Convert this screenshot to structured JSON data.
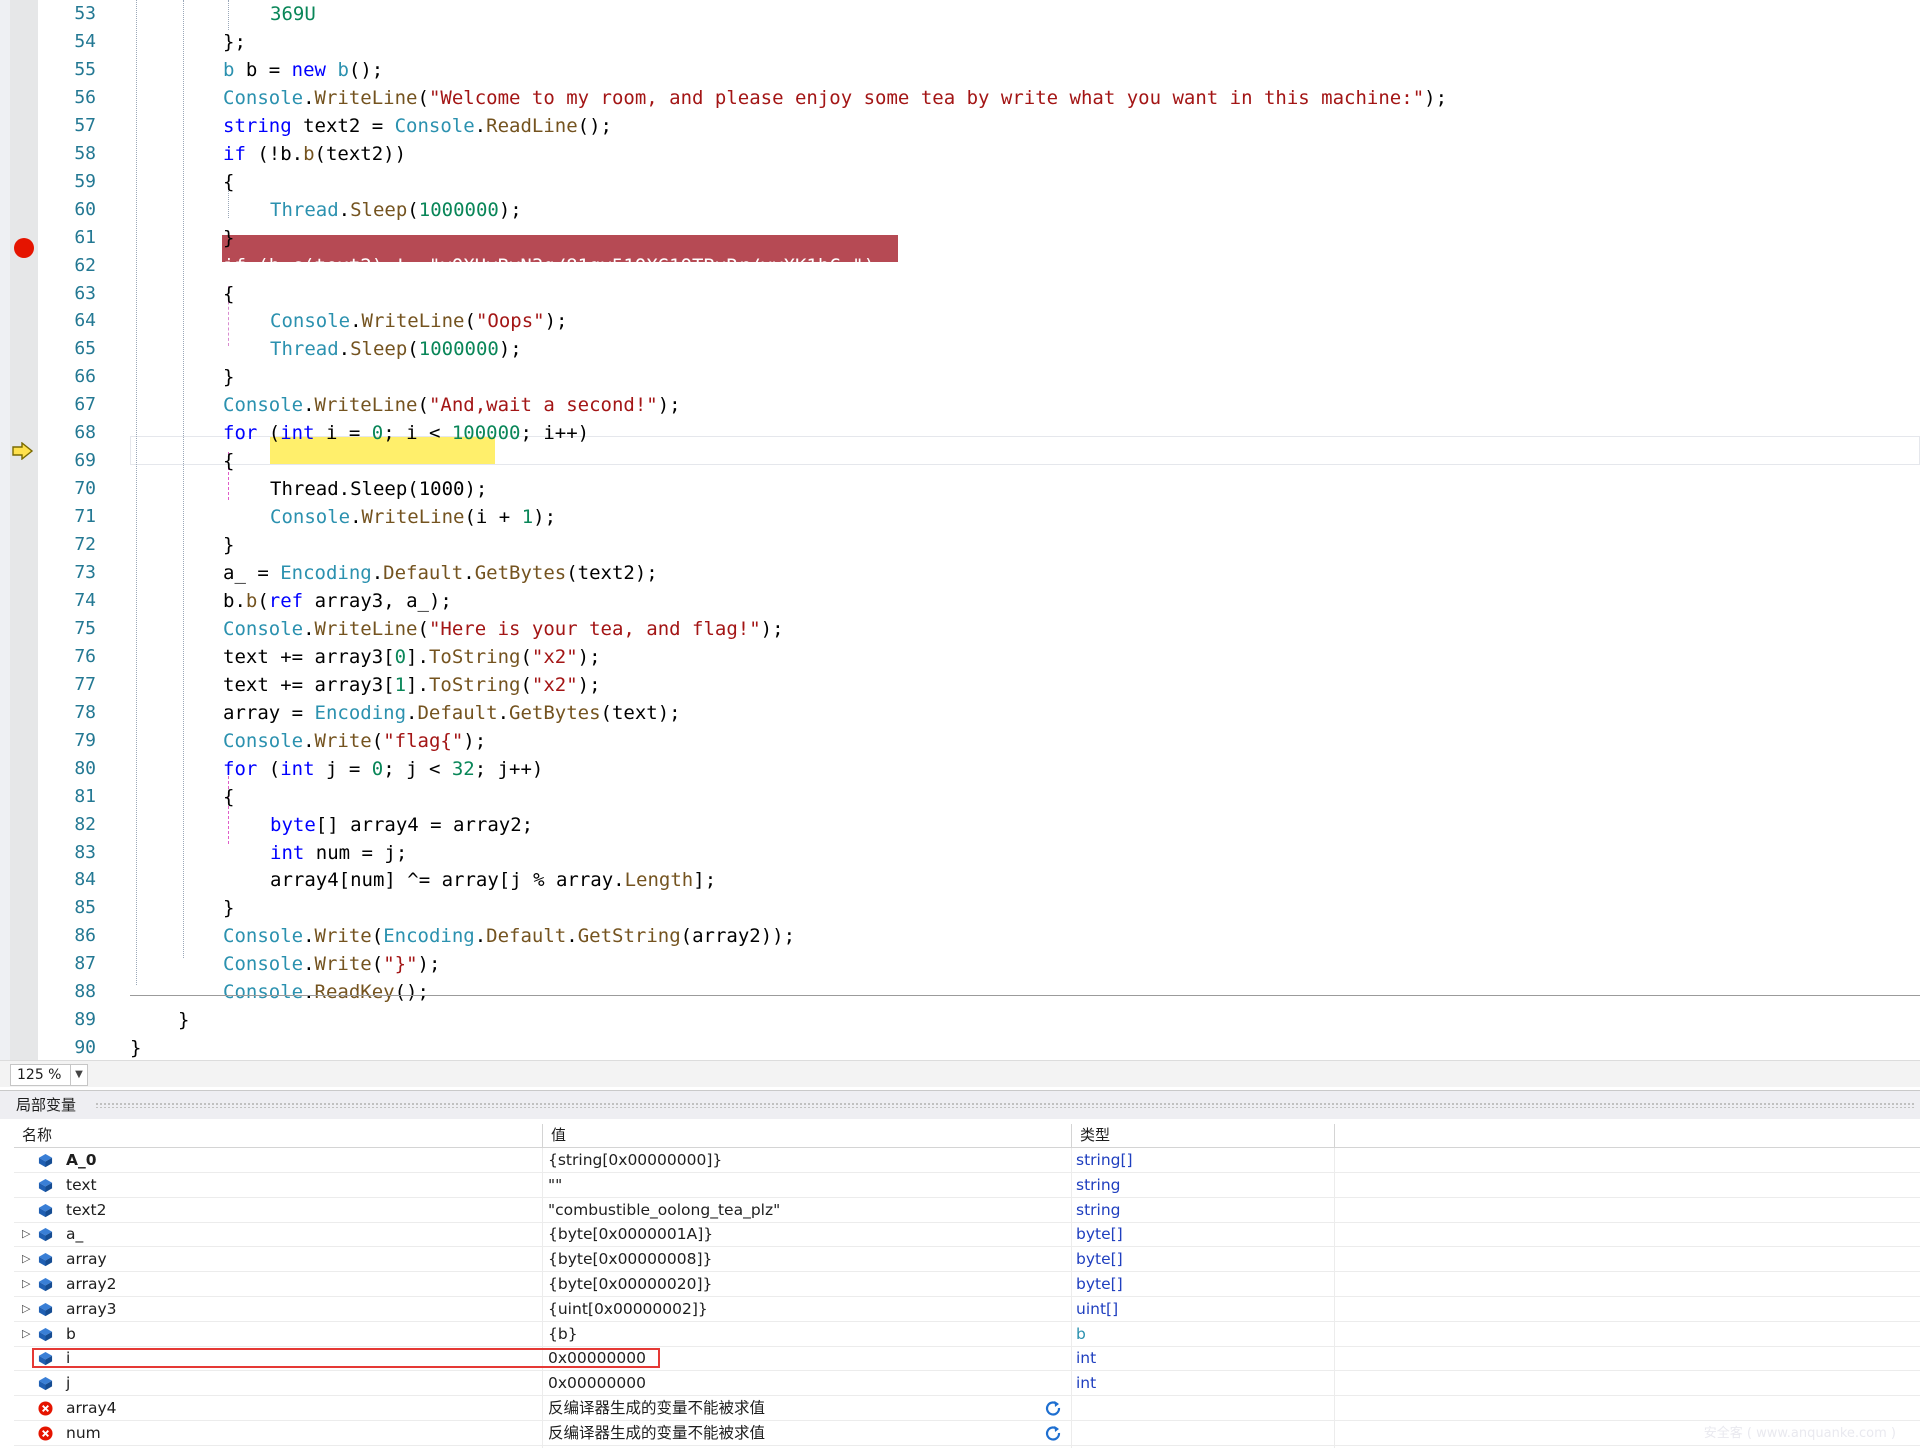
{
  "editor": {
    "zoom": "125 %",
    "lines": [
      {
        "n": "53",
        "indent": 2,
        "t": [
          [
            "num",
            "369U"
          ]
        ]
      },
      {
        "n": "54",
        "indent": 1,
        "t": [
          [
            "",
            "};"
          ]
        ]
      },
      {
        "n": "55",
        "indent": 1,
        "t": [
          [
            "typ",
            "b"
          ],
          [
            "",
            " b = "
          ],
          [
            "kw",
            "new"
          ],
          [
            "",
            " "
          ],
          [
            "typ",
            "b"
          ],
          [
            "",
            "();"
          ]
        ]
      },
      {
        "n": "56",
        "indent": 1,
        "t": [
          [
            "typ",
            "Console"
          ],
          [
            "",
            "."
          ],
          [
            "fn",
            "WriteLine"
          ],
          [
            "",
            "("
          ],
          [
            "str",
            "\"Welcome to my room, and please enjoy some tea by write what you want in this machine:\""
          ],
          [
            "",
            ");"
          ]
        ]
      },
      {
        "n": "57",
        "indent": 1,
        "t": [
          [
            "kw",
            "string"
          ],
          [
            "",
            " text2 = "
          ],
          [
            "typ",
            "Console"
          ],
          [
            "",
            "."
          ],
          [
            "fn",
            "ReadLine"
          ],
          [
            "",
            "();"
          ]
        ]
      },
      {
        "n": "58",
        "indent": 1,
        "t": [
          [
            "kw",
            "if"
          ],
          [
            "",
            " (!b."
          ],
          [
            "fn",
            "b"
          ],
          [
            "",
            "(text2))"
          ]
        ]
      },
      {
        "n": "59",
        "indent": 1,
        "t": [
          [
            "",
            "{"
          ]
        ]
      },
      {
        "n": "60",
        "indent": 2,
        "t": [
          [
            "typ",
            "Thread"
          ],
          [
            "",
            "."
          ],
          [
            "fn",
            "Sleep"
          ],
          [
            "",
            "("
          ],
          [
            "num",
            "1000000"
          ],
          [
            "",
            ");"
          ]
        ]
      },
      {
        "n": "61",
        "indent": 1,
        "t": [
          [
            "",
            "}"
          ]
        ]
      },
      {
        "n": "62",
        "indent": 1,
        "bp": true,
        "t": [
          [
            "",
            "if (b.c(text2) != \"yQXHyBvN3g/81gv51QXG1QTBxRr/yvXK1hC=\")"
          ]
        ]
      },
      {
        "n": "63",
        "indent": 1,
        "t": [
          [
            "",
            "{"
          ]
        ]
      },
      {
        "n": "64",
        "indent": 2,
        "t": [
          [
            "typ",
            "Console"
          ],
          [
            "",
            "."
          ],
          [
            "fn",
            "WriteLine"
          ],
          [
            "",
            "("
          ],
          [
            "str",
            "\"Oops\""
          ],
          [
            "",
            ");"
          ]
        ]
      },
      {
        "n": "65",
        "indent": 2,
        "t": [
          [
            "typ",
            "Thread"
          ],
          [
            "",
            "."
          ],
          [
            "fn",
            "Sleep"
          ],
          [
            "",
            "("
          ],
          [
            "num",
            "1000000"
          ],
          [
            "",
            ");"
          ]
        ]
      },
      {
        "n": "66",
        "indent": 1,
        "t": [
          [
            "",
            "}"
          ]
        ]
      },
      {
        "n": "67",
        "indent": 1,
        "t": [
          [
            "typ",
            "Console"
          ],
          [
            "",
            "."
          ],
          [
            "fn",
            "WriteLine"
          ],
          [
            "",
            "("
          ],
          [
            "str",
            "\"And,wait a second!\""
          ],
          [
            "",
            ");"
          ]
        ]
      },
      {
        "n": "68",
        "indent": 1,
        "t": [
          [
            "kw",
            "for"
          ],
          [
            "",
            " ("
          ],
          [
            "kw",
            "int"
          ],
          [
            "",
            " i = "
          ],
          [
            "num",
            "0"
          ],
          [
            "",
            "; i < "
          ],
          [
            "num",
            "100000"
          ],
          [
            "",
            "; i++)"
          ]
        ]
      },
      {
        "n": "69",
        "indent": 1,
        "t": [
          [
            "",
            "{"
          ]
        ]
      },
      {
        "n": "70",
        "indent": 2,
        "cur": true,
        "t": [
          [
            "",
            "Thread.Sleep(1000);"
          ]
        ]
      },
      {
        "n": "71",
        "indent": 2,
        "t": [
          [
            "typ",
            "Console"
          ],
          [
            "",
            "."
          ],
          [
            "fn",
            "WriteLine"
          ],
          [
            "",
            "(i + "
          ],
          [
            "num",
            "1"
          ],
          [
            "",
            ");"
          ]
        ]
      },
      {
        "n": "72",
        "indent": 1,
        "t": [
          [
            "",
            "}"
          ]
        ]
      },
      {
        "n": "73",
        "indent": 1,
        "t": [
          [
            "",
            "a_ = "
          ],
          [
            "typ",
            "Encoding"
          ],
          [
            "",
            "."
          ],
          [
            "fn",
            "Default"
          ],
          [
            "",
            "."
          ],
          [
            "fn",
            "GetBytes"
          ],
          [
            "",
            "(text2);"
          ]
        ]
      },
      {
        "n": "74",
        "indent": 1,
        "t": [
          [
            "",
            "b."
          ],
          [
            "fn",
            "b"
          ],
          [
            "",
            "("
          ],
          [
            "kw",
            "ref"
          ],
          [
            "",
            " array3, a_);"
          ]
        ]
      },
      {
        "n": "75",
        "indent": 1,
        "t": [
          [
            "typ",
            "Console"
          ],
          [
            "",
            "."
          ],
          [
            "fn",
            "WriteLine"
          ],
          [
            "",
            "("
          ],
          [
            "str",
            "\"Here is your tea, and flag!\""
          ],
          [
            "",
            ");"
          ]
        ]
      },
      {
        "n": "76",
        "indent": 1,
        "t": [
          [
            "",
            "text += array3["
          ],
          [
            "num",
            "0"
          ],
          [
            "",
            "]."
          ],
          [
            "fn",
            "ToString"
          ],
          [
            "",
            "("
          ],
          [
            "str",
            "\"x2\""
          ],
          [
            "",
            ");"
          ]
        ]
      },
      {
        "n": "77",
        "indent": 1,
        "t": [
          [
            "",
            "text += array3["
          ],
          [
            "num",
            "1"
          ],
          [
            "",
            "]."
          ],
          [
            "fn",
            "ToString"
          ],
          [
            "",
            "("
          ],
          [
            "str",
            "\"x2\""
          ],
          [
            "",
            ");"
          ]
        ]
      },
      {
        "n": "78",
        "indent": 1,
        "t": [
          [
            "",
            "array = "
          ],
          [
            "typ",
            "Encoding"
          ],
          [
            "",
            "."
          ],
          [
            "fn",
            "Default"
          ],
          [
            "",
            "."
          ],
          [
            "fn",
            "GetBytes"
          ],
          [
            "",
            "(text);"
          ]
        ]
      },
      {
        "n": "79",
        "indent": 1,
        "t": [
          [
            "typ",
            "Console"
          ],
          [
            "",
            "."
          ],
          [
            "fn",
            "Write"
          ],
          [
            "",
            "("
          ],
          [
            "str",
            "\"flag{\""
          ],
          [
            "",
            ");"
          ]
        ]
      },
      {
        "n": "80",
        "indent": 1,
        "t": [
          [
            "kw",
            "for"
          ],
          [
            "",
            " ("
          ],
          [
            "kw",
            "int"
          ],
          [
            "",
            " j = "
          ],
          [
            "num",
            "0"
          ],
          [
            "",
            "; j < "
          ],
          [
            "num",
            "32"
          ],
          [
            "",
            "; j++)"
          ]
        ]
      },
      {
        "n": "81",
        "indent": 1,
        "t": [
          [
            "",
            "{"
          ]
        ]
      },
      {
        "n": "82",
        "indent": 2,
        "t": [
          [
            "kw",
            "byte"
          ],
          [
            "",
            "[] array4 = array2;"
          ]
        ]
      },
      {
        "n": "83",
        "indent": 2,
        "t": [
          [
            "kw",
            "int"
          ],
          [
            "",
            " num = j;"
          ]
        ]
      },
      {
        "n": "84",
        "indent": 2,
        "t": [
          [
            "",
            "array4[num] ^= array[j % array."
          ],
          [
            "fn",
            "Length"
          ],
          [
            "",
            "];"
          ]
        ]
      },
      {
        "n": "85",
        "indent": 1,
        "t": [
          [
            "",
            "}"
          ]
        ]
      },
      {
        "n": "86",
        "indent": 1,
        "t": [
          [
            "typ",
            "Console"
          ],
          [
            "",
            "."
          ],
          [
            "fn",
            "Write"
          ],
          [
            "",
            "("
          ],
          [
            "typ",
            "Encoding"
          ],
          [
            "",
            "."
          ],
          [
            "fn",
            "Default"
          ],
          [
            "",
            "."
          ],
          [
            "fn",
            "GetString"
          ],
          [
            "",
            "(array2));"
          ]
        ]
      },
      {
        "n": "87",
        "indent": 1,
        "t": [
          [
            "typ",
            "Console"
          ],
          [
            "",
            "."
          ],
          [
            "fn",
            "Write"
          ],
          [
            "",
            "("
          ],
          [
            "str",
            "\"}\""
          ],
          [
            "",
            ");"
          ]
        ]
      },
      {
        "n": "88",
        "indent": 1,
        "t": [
          [
            "typ",
            "Console"
          ],
          [
            "",
            "."
          ],
          [
            "fn",
            "ReadKey"
          ],
          [
            "",
            "();"
          ]
        ]
      },
      {
        "n": "89",
        "indent": -1,
        "t": [
          [
            "",
            "}"
          ]
        ]
      },
      {
        "n": "90",
        "indent": -2,
        "t": [
          [
            "",
            "}"
          ]
        ]
      },
      {
        "n": "91",
        "indent": -2,
        "t": [
          [
            "",
            ""
          ]
        ]
      }
    ]
  },
  "locals": {
    "title": "局部变量",
    "headers": {
      "name": "名称",
      "value": "值",
      "type": "类型"
    },
    "rows": [
      {
        "expand": false,
        "icon": "field",
        "name": "A_0",
        "bold": true,
        "value": "{string[0x00000000]}",
        "value_style": "blue",
        "type": "string[]",
        "type_style": "blue"
      },
      {
        "expand": false,
        "icon": "field",
        "name": "text",
        "value": "\"\"",
        "value_style": "red",
        "type": "string",
        "type_style": "blue"
      },
      {
        "expand": false,
        "icon": "field",
        "name": "text2",
        "value": "\"combustible_oolong_tea_plz\"",
        "value_style": "red",
        "type": "string",
        "type_style": "blue"
      },
      {
        "expand": true,
        "icon": "field",
        "name": "a_",
        "value": "{byte[0x0000001A]}",
        "value_style": "blue",
        "type": "byte[]",
        "type_style": "blue"
      },
      {
        "expand": true,
        "icon": "field",
        "name": "array",
        "value": "{byte[0x00000008]}",
        "value_style": "blue",
        "type": "byte[]",
        "type_style": "blue"
      },
      {
        "expand": true,
        "icon": "field",
        "name": "array2",
        "value": "{byte[0x00000020]}",
        "value_style": "blue",
        "type": "byte[]",
        "type_style": "blue"
      },
      {
        "expand": true,
        "icon": "field",
        "name": "array3",
        "value": "{uint[0x00000002]}",
        "value_style": "blue",
        "type": "uint[]",
        "type_style": "blue"
      },
      {
        "expand": true,
        "icon": "field",
        "name": "b",
        "value": "{b}",
        "value_style": "blue",
        "type": "b",
        "type_style": "cyan"
      },
      {
        "expand": false,
        "icon": "field",
        "name": "i",
        "highlighted": true,
        "value": "0x00000000",
        "value_style": "blue",
        "type": "int",
        "type_style": "blue"
      },
      {
        "expand": false,
        "icon": "field",
        "name": "j",
        "value": "0x00000000",
        "value_style": "blue",
        "type": "int",
        "type_style": "blue"
      },
      {
        "expand": false,
        "icon": "error",
        "name": "array4",
        "value": "反编译器生成的变量不能被求值",
        "value_style": "err",
        "type": "",
        "refresh": true
      },
      {
        "expand": false,
        "icon": "error",
        "name": "num",
        "value": "反编译器生成的变量不能被求值",
        "value_style": "err",
        "type": "",
        "refresh": true
      }
    ]
  },
  "watermark": "安全客 ( www.anquanke.com )",
  "colors": {
    "breakpoint": "#e51400",
    "breakpoint_line": "#b64a54",
    "current_line": "#ffef6b",
    "highlight_box": "#e53935"
  }
}
